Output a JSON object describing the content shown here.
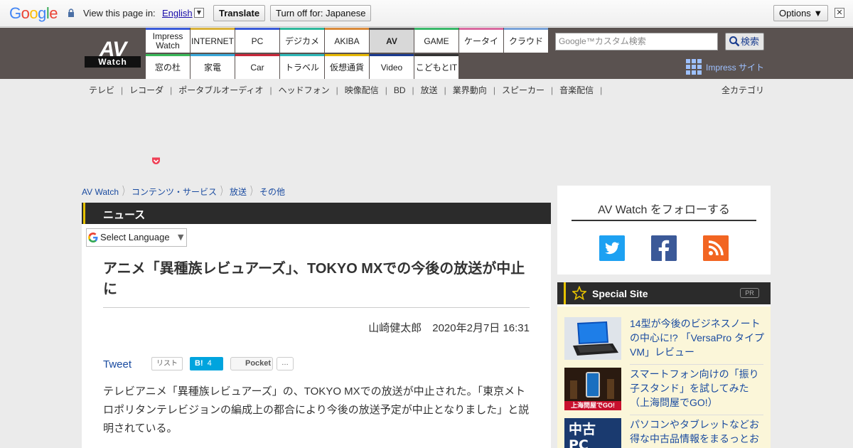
{
  "translate_bar": {
    "logo": "Google",
    "view_label": "View this page in:",
    "language": "English",
    "language_arrow": "▼",
    "translate_button": "Translate",
    "turn_off_button": "Turn off for: Japanese",
    "options_button": "Options ▼",
    "close": "✕"
  },
  "logo": {
    "top": "AV",
    "bottom": "Watch"
  },
  "nav": {
    "top_row": [
      {
        "label": "Impress Watch",
        "color": "#3a5bd9"
      },
      {
        "label": "INTERNET",
        "color": "#d9b23a"
      },
      {
        "label": "PC",
        "color": "#3a5bd9"
      },
      {
        "label": "デジカメ",
        "color": "#2fb89b"
      },
      {
        "label": "AKIBA",
        "color": "#d98a3a"
      },
      {
        "label": "AV",
        "color": "#555555"
      },
      {
        "label": "GAME",
        "color": "#3ab86a"
      },
      {
        "label": "ケータイ",
        "color": "#d96aa0"
      },
      {
        "label": "クラウド",
        "color": "#7aa3d9"
      }
    ],
    "bottom_row": [
      {
        "label": "窓の杜",
        "color": "#3ab85a"
      },
      {
        "label": "家電",
        "color": "#3aa8d9"
      },
      {
        "label": "Car",
        "color": "#c8283a"
      },
      {
        "label": "トラベル",
        "color": "#2fb8b8"
      },
      {
        "label": "仮想通貨",
        "color": "#e6b800"
      },
      {
        "label": "Video",
        "color": "#1a3a8f"
      },
      {
        "label": "こどもとIT",
        "color": "#333333"
      }
    ]
  },
  "search": {
    "placeholder": "Google™カスタム検索",
    "button": "検索"
  },
  "impress_site": "Impress サイト",
  "subnav": [
    "テレビ",
    "レコーダ",
    "ポータブルオーディオ",
    "ヘッドフォン",
    "映像配信",
    "BD",
    "放送",
    "業界動向",
    "スピーカー",
    "音楽配信"
  ],
  "all_categories": "全カテゴリ",
  "breadcrumb": [
    "AV Watch",
    "コンテンツ・サービス",
    "放送",
    "その他"
  ],
  "article": {
    "section": "ニュース",
    "lang_select": "Select Language",
    "lang_select_arrow": "▼",
    "headline": "アニメ「異種族レビュアーズ」、TOKYO MXでの今後の放送が中止に",
    "byline": "山崎健太郎　2020年2月7日 16:31",
    "tweet": "Tweet",
    "list": "リスト",
    "hatena": "B!",
    "hatena_count": "4",
    "pocket": "Pocket",
    "more": "…",
    "body": "テレビアニメ「異種族レビュアーズ」の、TOKYO MXでの放送が中止された。「東京メトロポリタンテレビジョンの編成上の都合により今後の放送予定が中止となりました」と説明されている。"
  },
  "follow": {
    "title": "AV Watch をフォローする"
  },
  "special": {
    "title": "Special Site",
    "pr": "PR",
    "items": [
      {
        "text": "14型が今後のビジネスノートの中心に!? 「VersaPro タイプVM」レビュー"
      },
      {
        "text": "スマートフォン向けの「振り子スタンド」を試してみた（上海問屋でGO!）",
        "thumb_caption": "上海問屋でGO!"
      },
      {
        "text": "パソコンやタブレットなどお得な中古品情報をまるっとお",
        "thumb_caption": "中古PC"
      }
    ]
  }
}
